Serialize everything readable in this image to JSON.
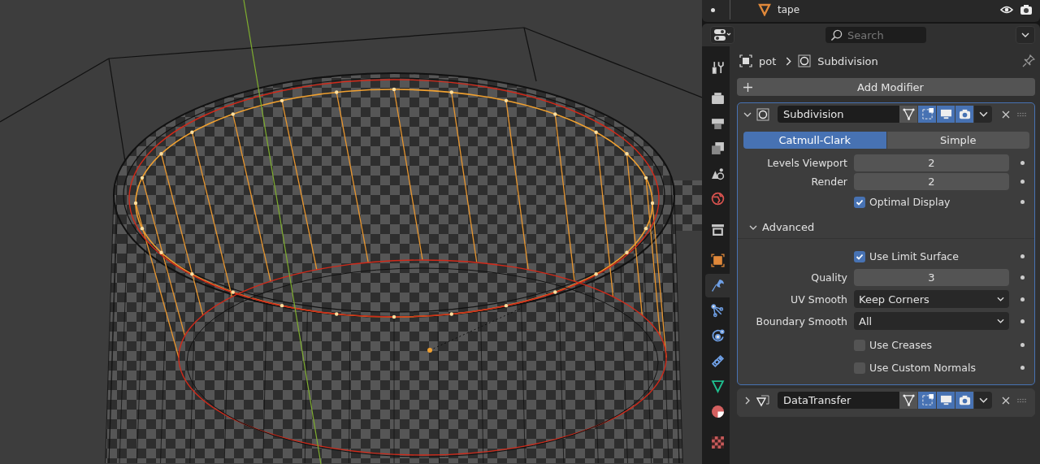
{
  "outliner": {
    "rows": [
      {
        "name": "tape",
        "visible": true
      }
    ]
  },
  "properties": {
    "search": {
      "placeholder": "Search"
    },
    "breadcrumb": [
      "pot",
      "Subdivision"
    ],
    "tabs": [
      {
        "kind": "tool",
        "selected": false
      },
      {
        "kind": "render",
        "selected": false
      },
      {
        "kind": "output",
        "selected": false
      },
      {
        "kind": "view_layer",
        "selected": false
      },
      {
        "kind": "scene",
        "selected": false
      },
      {
        "kind": "world",
        "selected": false
      },
      {
        "kind": "collection",
        "selected": false
      },
      {
        "kind": "object",
        "selected": false
      },
      {
        "kind": "modifier",
        "selected": true
      },
      {
        "kind": "particles",
        "selected": false
      },
      {
        "kind": "physics",
        "selected": false
      },
      {
        "kind": "constraints",
        "selected": false
      },
      {
        "kind": "data",
        "selected": false
      },
      {
        "kind": "material",
        "selected": false
      },
      {
        "kind": "texture",
        "selected": false
      }
    ],
    "add_modifier": "Add Modifier",
    "modifiers": [
      {
        "kind": "subdivision",
        "name": "Subdivision",
        "expanded": true,
        "active": true,
        "toggles": [
          {
            "kind": "on_cage",
            "on": false
          },
          {
            "kind": "edit_mode",
            "on": true
          },
          {
            "kind": "viewport",
            "on": true
          },
          {
            "kind": "render",
            "on": true
          }
        ],
        "types": [
          {
            "label": "Catmull-Clark",
            "selected": true
          },
          {
            "label": "Simple",
            "selected": false
          }
        ],
        "rows": [
          {
            "kind": "number",
            "label": "Levels Viewport",
            "value": "2"
          },
          {
            "kind": "number",
            "label": "Render",
            "value": "2"
          },
          {
            "kind": "checkbox",
            "label": "Optimal Display",
            "checked": true
          }
        ],
        "advanced": {
          "label": "Advanced",
          "expanded": true,
          "rows": [
            {
              "kind": "checkbox",
              "label": "Use Limit Surface",
              "checked": true
            },
            {
              "kind": "number",
              "label": "Quality",
              "value": "3"
            },
            {
              "kind": "dropdown",
              "label": "UV Smooth",
              "value": "Keep Corners"
            },
            {
              "kind": "dropdown",
              "label": "Boundary Smooth",
              "value": "All"
            },
            {
              "kind": "checkbox",
              "label": "Use Creases",
              "checked": false
            },
            {
              "kind": "checkbox",
              "label": "Use Custom Normals",
              "checked": false
            }
          ]
        }
      },
      {
        "kind": "data_transfer",
        "name": "DataTransfer",
        "expanded": false,
        "active": false,
        "toggles": [
          {
            "kind": "on_cage",
            "on": false
          },
          {
            "kind": "edit_mode",
            "on": true
          },
          {
            "kind": "viewport",
            "on": true
          },
          {
            "kind": "render",
            "on": true
          }
        ]
      }
    ]
  }
}
